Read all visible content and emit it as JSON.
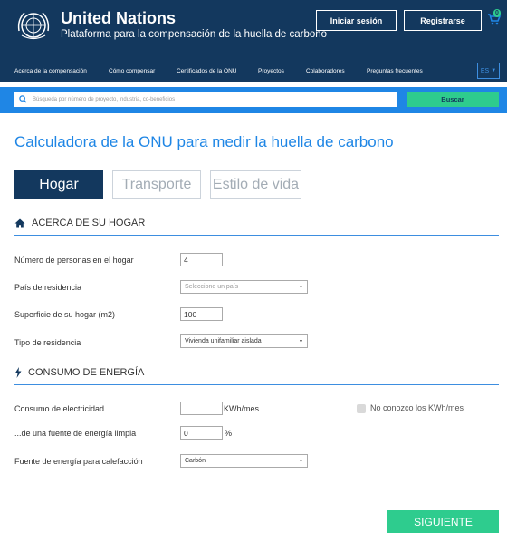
{
  "header": {
    "brand_title": "United Nations",
    "brand_subtitle": "Plataforma para la compensación de la huella de carbono",
    "login_label": "Iniciar sesión",
    "register_label": "Registrarse",
    "cart_count": "0"
  },
  "nav": {
    "items": [
      "Acerca de la compensación",
      "Cómo compensar",
      "Certificados de la ONU",
      "Proyectos",
      "Colaboradores",
      "Preguntas frecuentes"
    ],
    "lang": "ES"
  },
  "search": {
    "placeholder": "Búsqueda por número de proyecto, industria, co-beneficios",
    "button_label": "Buscar"
  },
  "main": {
    "title": "Calculadora de la ONU para medir la huella de carbono",
    "tabs": [
      "Hogar",
      "Transporte",
      "Estilo de vida"
    ],
    "section_home": {
      "title": "ACERCA DE SU HOGAR",
      "people_label": "Número de personas en el hogar",
      "people_value": "4",
      "country_label": "País de residencia",
      "country_placeholder": "Seleccione un país",
      "area_label": "Superficie de su hogar (m2)",
      "area_value": "100",
      "type_label": "Tipo de residencia",
      "type_value": "Vivienda unifamiliar aislada"
    },
    "section_energy": {
      "title": "CONSUMO DE ENERGÍA",
      "electricity_label": "Consumo de electricidad",
      "electricity_value": "",
      "electricity_unit": "KWh/mes",
      "unknown_label": "No conozco los KWh/mes",
      "clean_label": "...de una fuente de energía limpia",
      "clean_value": "0",
      "clean_unit": "%",
      "heating_label": "Fuente de energía para calefacción",
      "heating_value": "Carbón"
    },
    "next_label": "SIGUIENTE"
  },
  "colors": {
    "navy": "#13385e",
    "blue": "#1f86e5",
    "green": "#2ecc8e"
  }
}
